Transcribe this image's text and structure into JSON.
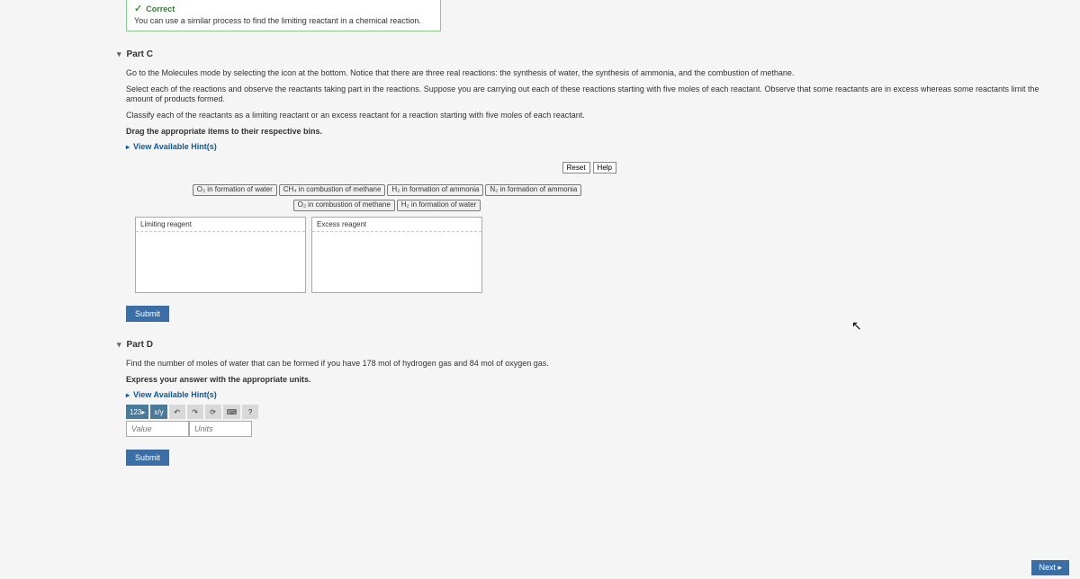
{
  "hint": {
    "correct_label": "Correct",
    "text": "You can use a similar process to find the limiting reactant in a chemical reaction."
  },
  "partC": {
    "title": "Part C",
    "instructions1": "Go to the Molecules mode by selecting the icon at the bottom. Notice that there are three real reactions: the synthesis of water, the synthesis of ammonia, and the combustion of methane.",
    "instructions2": "Select each of the reactions and observe the reactants taking part in the reactions. Suppose you are carrying out each of these reactions starting with five moles of each reactant. Observe that some reactants are in excess whereas some reactants limit the amount of products formed.",
    "instructions3": "Classify each of the reactants as a limiting reactant or an excess reactant for a reaction starting with five moles of each reactant.",
    "instructions4": "Drag the appropriate items to their respective bins.",
    "hints_link": "View Available Hint(s)",
    "reset": "Reset",
    "help": "Help",
    "chips": {
      "o2_water": "O₂ in formation of water",
      "ch4_methane": "CH₄ in combustion of methane",
      "h2_ammonia": "H₂ in formation of ammonia",
      "n2_ammonia": "N₂ in formation of ammonia",
      "o2_methane": "O₂ in combustion of methane",
      "h2_water": "H₂ in formation of water"
    },
    "bin_limiting": "Limiting reagent",
    "bin_excess": "Excess reagent",
    "submit": "Submit"
  },
  "partD": {
    "title": "Part D",
    "instructions1": "Find the number of moles of water that can be formed if you have 178 mol of hydrogen gas and 84 mol of oxygen gas.",
    "instructions2": "Express your answer with the appropriate units.",
    "hints_link": "View Available Hint(s)",
    "toolbar": {
      "nums": "123▸",
      "frac": "x/y",
      "undo": "↶",
      "redo": "↷",
      "reset": "⟳",
      "kbd": "⌨",
      "help": "?"
    },
    "value_placeholder": "Value",
    "units_placeholder": "Units",
    "submit": "Submit"
  },
  "next": "Next ▸"
}
